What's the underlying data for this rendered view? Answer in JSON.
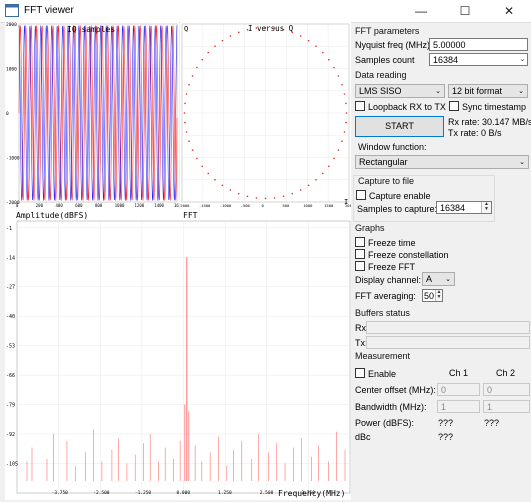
{
  "window": {
    "title": "FFT viewer",
    "minimize_glyph": "—",
    "maximize_glyph": "☐",
    "close_glyph": "✕",
    "icon_name": "app-window-icon"
  },
  "iq_plot": {
    "title": "IQ samples",
    "y_ticks": [
      "2000",
      "1000",
      "0",
      "-1000",
      "-2000"
    ],
    "x_ticks": [
      "0",
      "200",
      "400",
      "600",
      "800",
      "1000",
      "1200",
      "1400",
      "1600"
    ],
    "colors": {
      "i": "#ff2020",
      "q": "#2020ff"
    }
  },
  "const_plot": {
    "title": "I versus Q",
    "corner_label": "Q",
    "axis_label": "I",
    "x_ticks": [
      "-2000",
      "-1500",
      "-1000",
      "-500",
      "0",
      "500",
      "1000",
      "1500",
      "2000"
    ],
    "color": "#e03030"
  },
  "fft_plot": {
    "title": "FFT",
    "ylabel": "Amplitude(dBFS)",
    "xlabel": "Frequency(MHz)",
    "y_ticks": [
      "-1",
      "-14",
      "-27",
      "-40",
      "-53",
      "-66",
      "-79",
      "-92",
      "-105"
    ],
    "x_ticks": [
      "-3.750",
      "-2.500",
      "-1.250",
      "0.000",
      "1.250",
      "2.500",
      "3.750"
    ],
    "color": "#ff7070",
    "peak_freq_mhz": 0.1,
    "peak_dbfs": -14
  },
  "panel": {
    "fft_params_title": "FFT parameters",
    "nyquist_label": "Nyquist freq (MHz):",
    "nyquist_value": "5.00000",
    "samples_label": "Samples count",
    "samples_value": "16384",
    "data_reading_title": "Data reading",
    "mode_value": "LMS SISO",
    "format_value": "12 bit format",
    "loopback_label": "Loopback RX to TX",
    "sync_label": "Sync timestamp",
    "rx_rate": "Rx rate: 30.147 MB/s",
    "tx_rate": "Tx rate: 0 B/s",
    "start_label": "START",
    "window_fn_label": "Window function:",
    "window_fn_value": "Rectangular",
    "capture_title": "Capture to file",
    "capture_enable_label": "Capture enable",
    "samples_to_capture_label": "Samples to capture:",
    "samples_to_capture_value": "16384",
    "graphs_title": "Graphs",
    "freeze_time_label": "Freeze time",
    "freeze_const_label": "Freeze constellation",
    "freeze_fft_label": "Freeze FFT",
    "display_channel_label": "Display channel:",
    "display_channel_value": "A",
    "fft_avg_label": "FFT averaging:",
    "fft_avg_value": "50",
    "buffers_title": "Buffers status",
    "rx_label": "Rx:",
    "tx_label": "Tx:",
    "measurement_title": "Measurement",
    "enable_label": "Enable",
    "ch1_label": "Ch 1",
    "ch2_label": "Ch 2",
    "center_offset_label": "Center offset (MHz):",
    "center_offset_ch1": "0",
    "center_offset_ch2": "0",
    "bandwidth_label": "Bandwidth (MHz):",
    "bandwidth_ch1": "1",
    "bandwidth_ch2": "1",
    "power_label": "Power (dBFS):",
    "power_ch1": "???",
    "power_ch2": "???",
    "dbc_label": "dBc",
    "dbc_ch1": "???"
  }
}
